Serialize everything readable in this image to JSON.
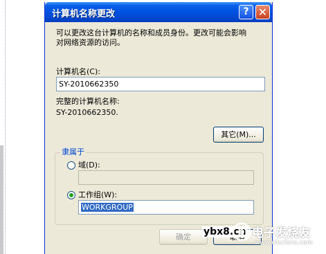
{
  "dialog": {
    "title": "计算机名称更改",
    "help_glyph": "?",
    "close_glyph": "✕",
    "description_line1": "可以更改这台计算机的名称和成员身份。更改可能会影响",
    "description_line2": "对网络资源的访问。",
    "computer_name_label": "计算机名(C):",
    "computer_name_value": "SY-2010662350",
    "full_name_label": "完整的计算机名称:",
    "full_name_value": "SY-2010662350.",
    "more_button": "其它(M)...",
    "member_of_label": "隶属于",
    "domain_label": "域(D):",
    "domain_value": "",
    "workgroup_label": "工作组(W):",
    "workgroup_value": "WORKGROUP",
    "ok_button": "确定",
    "cancel_button": "取消"
  },
  "watermark": {
    "site": "ybx8.cn",
    "brand": "电子发烧友",
    "url": "www.elecfans.com"
  },
  "colors": {
    "titlebar": "#0054e3",
    "dialog_bg": "#ece9d8",
    "group_label": "#0046d5",
    "selection": "#316ac5"
  }
}
